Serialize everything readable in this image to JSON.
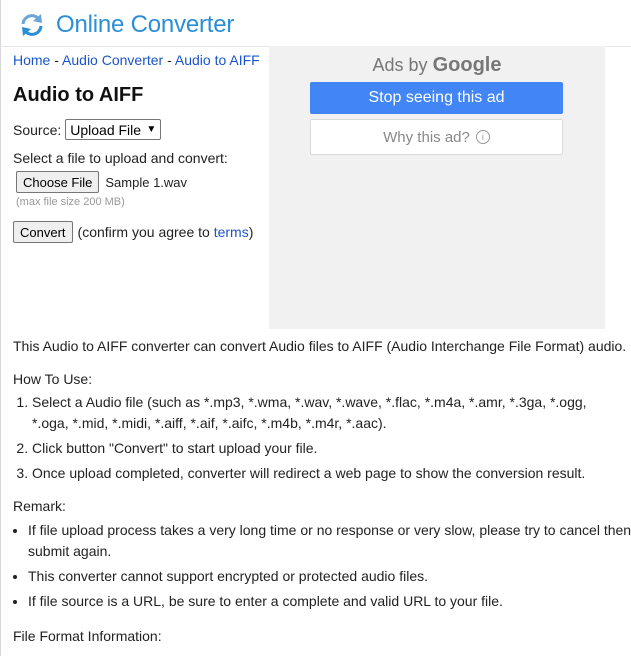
{
  "header": {
    "brand": "Online Converter",
    "logo_icon": "refresh-arrows-icon"
  },
  "breadcrumb": {
    "home": "Home",
    "sep1": " - ",
    "audio_converter": "Audio Converter",
    "sep2": " - ",
    "current": "Audio to AIFF"
  },
  "page": {
    "title": "Audio to AIFF"
  },
  "form": {
    "source_label": "Source:",
    "source_selected": "Upload File",
    "select_prompt": "Select a file to upload and convert:",
    "choose_file_button": "Choose File",
    "file_name": "Sample 1.wav",
    "max_size": "(max file size 200 MB)",
    "convert_button": "Convert",
    "confirm_text_before": "(confirm you agree to ",
    "terms_link": "terms",
    "confirm_text_after": ")"
  },
  "ad": {
    "ads_by": "Ads by",
    "google": "Google",
    "stop_seeing": "Stop seeing this ad",
    "why_this_ad": "Why this ad?",
    "info_glyph": "i",
    "colors": {
      "stop_button": "#4285f4",
      "background": "#f1f1f1"
    }
  },
  "content": {
    "description": "This Audio to AIFF converter can convert Audio files to AIFF (Audio Interchange File Format) audio.",
    "howto_title": "How To Use:",
    "steps": [
      "Select a Audio file (such as *.mp3, *.wma, *.wav, *.wave, *.flac, *.m4a, *.amr, *.3ga, *.ogg, *.oga, *.mid, *.midi, *.aiff, *.aif, *.aifc, *.m4b, *.m4r, *.aac).",
      "Click button \"Convert\" to start upload your file.",
      "Once upload completed, converter will redirect a web page to show the conversion result."
    ],
    "remark_title": "Remark:",
    "remarks": [
      "If file upload process takes a very long time or no response or very slow, please try to cancel then submit again.",
      "This converter cannot support encrypted or protected audio files.",
      "If file source is a URL, be sure to enter a complete and valid URL to your file."
    ],
    "file_format_info": "File Format Information:"
  },
  "colors": {
    "brand": "#2a8fd6",
    "link": "#1a55c8"
  }
}
